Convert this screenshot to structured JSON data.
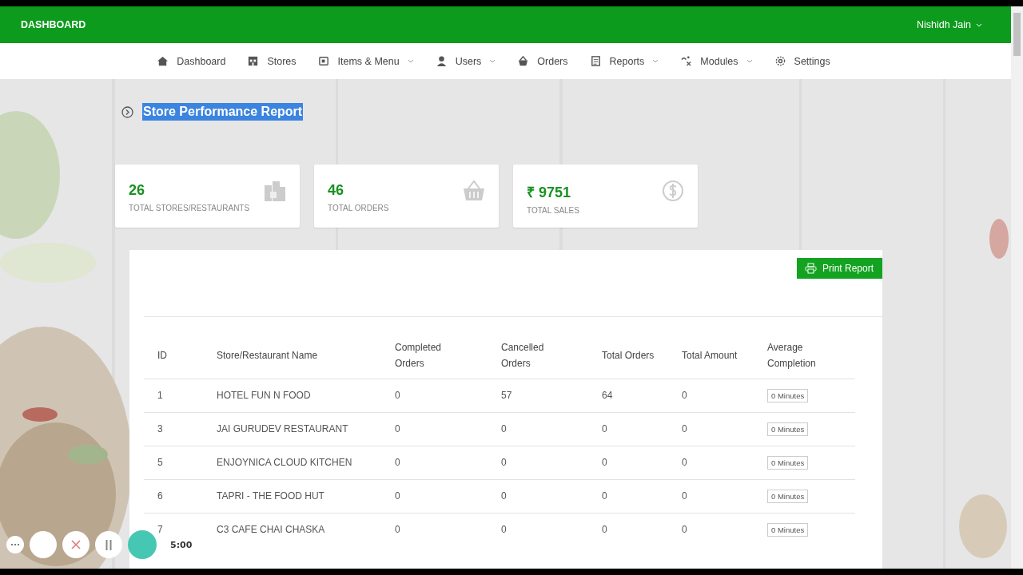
{
  "header": {
    "brand": "DASHBOARD",
    "user": "Nishidh Jain"
  },
  "nav": [
    {
      "label": "Dashboard",
      "dropdown": false
    },
    {
      "label": "Stores",
      "dropdown": false
    },
    {
      "label": "Items & Menu",
      "dropdown": true
    },
    {
      "label": "Users",
      "dropdown": true
    },
    {
      "label": "Orders",
      "dropdown": false
    },
    {
      "label": "Reports",
      "dropdown": true
    },
    {
      "label": "Modules",
      "dropdown": true
    },
    {
      "label": "Settings",
      "dropdown": false
    }
  ],
  "page_title": {
    "text": "Store Performance Report",
    "highlighted": true
  },
  "stats": [
    {
      "value": "26",
      "label": "TOTAL STORES/RESTAURANTS"
    },
    {
      "value": "46",
      "label": "TOTAL ORDERS"
    },
    {
      "value": "₹ 9751",
      "label": "TOTAL SALES"
    }
  ],
  "print_button": "Print Report",
  "table": {
    "columns": [
      "ID",
      "Store/Restaurant Name",
      "Completed Orders",
      "Cancelled Orders",
      "Total Orders",
      "Total Amount",
      "Average Completion"
    ],
    "rows": [
      [
        "1",
        "HOTEL FUN N FOOD",
        "0",
        "57",
        "64",
        "0",
        "0 Minutes"
      ],
      [
        "3",
        "JAI GURUDEV RESTAURANT",
        "0",
        "0",
        "0",
        "0",
        "0 Minutes"
      ],
      [
        "5",
        "ENJOYNICA CLOUD KITCHEN",
        "0",
        "0",
        "0",
        "0",
        "0 Minutes"
      ],
      [
        "6",
        "TAPRI - THE FOOD HUT",
        "0",
        "0",
        "0",
        "0",
        "0 Minutes"
      ],
      [
        "7",
        "C3 CAFE CHAI CHASKA",
        "0",
        "0",
        "0",
        "0",
        "0 Minutes"
      ]
    ]
  },
  "recorder": {
    "timer": "5:00"
  }
}
